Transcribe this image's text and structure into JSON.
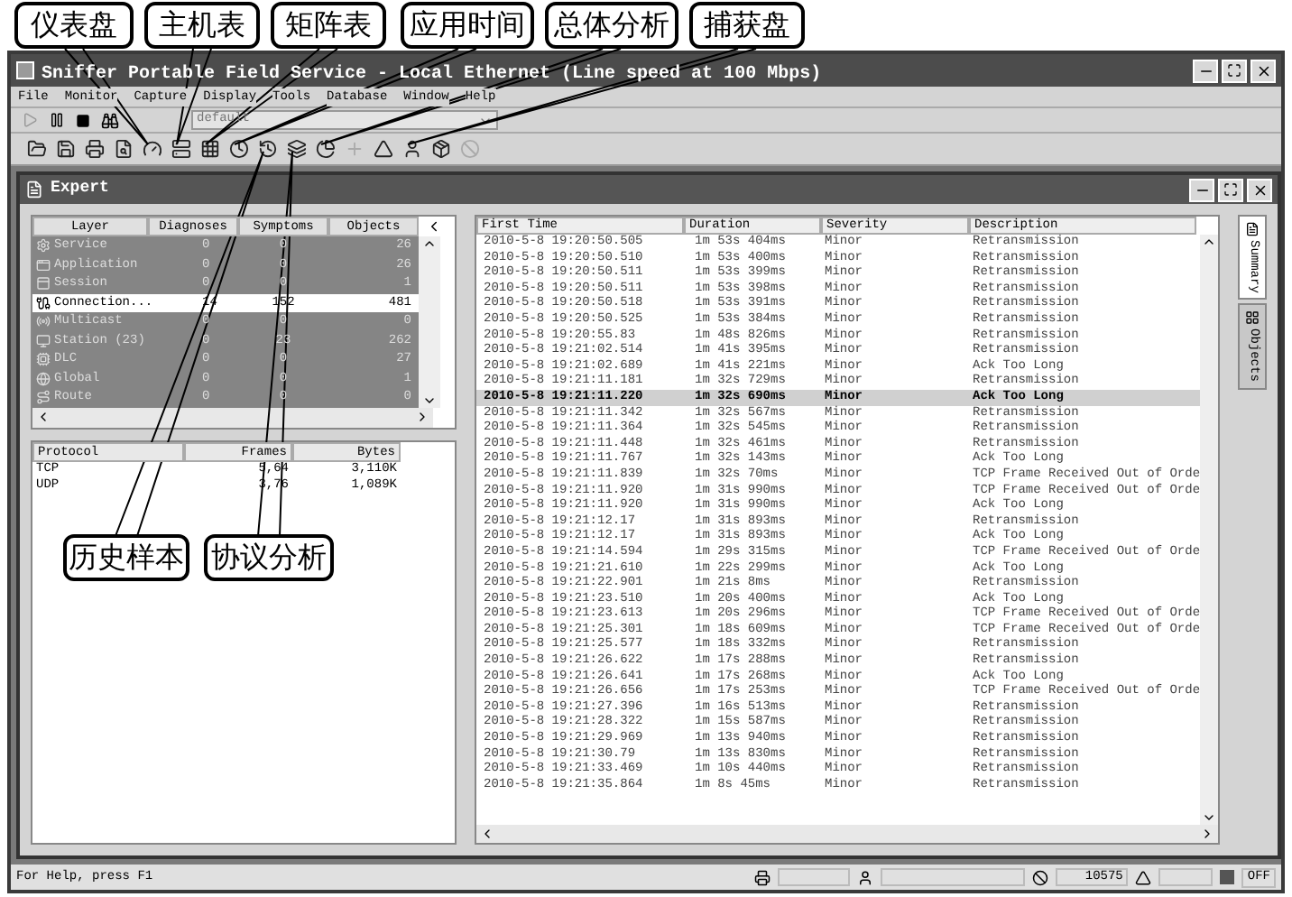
{
  "top_callouts": [
    "仪表盘",
    "主机表",
    "矩阵表",
    "应用时间",
    "总体分析",
    "捕获盘"
  ],
  "bottom_callouts": [
    "历史样本",
    "协议分析"
  ],
  "window": {
    "title": "Sniffer Portable Field Service - Local Ethernet (Line speed at 100 Mbps)"
  },
  "menu": [
    "File",
    "Monitor",
    "Capture",
    "Display",
    "Tools",
    "Database",
    "Window",
    "Help"
  ],
  "toolbar": {
    "dropdown": {
      "value": "default",
      "disabled": true
    }
  },
  "expert": {
    "title": "Expert",
    "layer_table": {
      "columns": [
        "Layer",
        "Diagnoses",
        "Symptoms",
        "Objects"
      ],
      "rows": [
        {
          "name": "Service",
          "diagnoses": "0",
          "symptoms": "0",
          "objects": "26",
          "selected": false
        },
        {
          "name": "Application",
          "diagnoses": "0",
          "symptoms": "0",
          "objects": "26",
          "selected": false
        },
        {
          "name": "Session",
          "diagnoses": "0",
          "symptoms": "0",
          "objects": "1",
          "selected": false
        },
        {
          "name": "Connection...",
          "diagnoses": "14",
          "symptoms": "152",
          "objects": "481",
          "selected": true
        },
        {
          "name": "Multicast",
          "diagnoses": "0",
          "symptoms": "0",
          "objects": "0",
          "selected": false
        },
        {
          "name": "Station (23)",
          "diagnoses": "0",
          "symptoms": "23",
          "objects": "262",
          "selected": false
        },
        {
          "name": "DLC",
          "diagnoses": "0",
          "symptoms": "0",
          "objects": "27",
          "selected": false
        },
        {
          "name": "Global",
          "diagnoses": "0",
          "symptoms": "0",
          "objects": "1",
          "selected": false
        },
        {
          "name": "Route",
          "diagnoses": "0",
          "symptoms": "0",
          "objects": "0",
          "selected": false
        }
      ]
    },
    "protocol_table": {
      "columns": [
        "Protocol",
        "Frames",
        "Bytes"
      ],
      "rows": [
        {
          "protocol": "TCP",
          "frames": "5,64",
          "bytes": "3,110K"
        },
        {
          "protocol": "UDP",
          "frames": "3,76",
          "bytes": "1,089K"
        }
      ]
    },
    "events_table": {
      "columns": [
        "First Time",
        "Duration",
        "Severity",
        "Description"
      ],
      "rows": [
        {
          "time": "2010-5-8 19:20:50.505",
          "duration": "1m 53s 404ms",
          "severity": "Minor",
          "description": "Retransmission",
          "selected": false
        },
        {
          "time": "2010-5-8 19:20:50.510",
          "duration": "1m 53s 400ms",
          "severity": "Minor",
          "description": "Retransmission",
          "selected": false
        },
        {
          "time": "2010-5-8 19:20:50.511",
          "duration": "1m 53s 399ms",
          "severity": "Minor",
          "description": "Retransmission",
          "selected": false
        },
        {
          "time": "2010-5-8 19:20:50.511",
          "duration": "1m 53s 398ms",
          "severity": "Minor",
          "description": "Retransmission",
          "selected": false
        },
        {
          "time": "2010-5-8 19:20:50.518",
          "duration": "1m 53s 391ms",
          "severity": "Minor",
          "description": "Retransmission",
          "selected": false
        },
        {
          "time": "2010-5-8 19:20:50.525",
          "duration": "1m 53s 384ms",
          "severity": "Minor",
          "description": "Retransmission",
          "selected": false
        },
        {
          "time": "2010-5-8 19:20:55.83",
          "duration": "1m 48s 826ms",
          "severity": "Minor",
          "description": "Retransmission",
          "selected": false
        },
        {
          "time": "2010-5-8 19:21:02.514",
          "duration": "1m 41s 395ms",
          "severity": "Minor",
          "description": "Retransmission",
          "selected": false
        },
        {
          "time": "2010-5-8 19:21:02.689",
          "duration": "1m 41s 221ms",
          "severity": "Minor",
          "description": "Ack Too Long",
          "selected": false
        },
        {
          "time": "2010-5-8 19:21:11.181",
          "duration": "1m 32s 729ms",
          "severity": "Minor",
          "description": "Retransmission",
          "selected": false
        },
        {
          "time": "2010-5-8 19:21:11.220",
          "duration": "1m 32s 690ms",
          "severity": "Minor",
          "description": "Ack Too Long",
          "selected": true
        },
        {
          "time": "2010-5-8 19:21:11.342",
          "duration": "1m 32s 567ms",
          "severity": "Minor",
          "description": "Retransmission",
          "selected": false
        },
        {
          "time": "2010-5-8 19:21:11.364",
          "duration": "1m 32s 545ms",
          "severity": "Minor",
          "description": "Retransmission",
          "selected": false
        },
        {
          "time": "2010-5-8 19:21:11.448",
          "duration": "1m 32s 461ms",
          "severity": "Minor",
          "description": "Retransmission",
          "selected": false
        },
        {
          "time": "2010-5-8 19:21:11.767",
          "duration": "1m 32s 143ms",
          "severity": "Minor",
          "description": "Ack Too Long",
          "selected": false
        },
        {
          "time": "2010-5-8 19:21:11.839",
          "duration": "1m 32s 70ms",
          "severity": "Minor",
          "description": "TCP Frame Received Out of Orde",
          "selected": false
        },
        {
          "time": "2010-5-8 19:21:11.920",
          "duration": "1m 31s 990ms",
          "severity": "Minor",
          "description": "TCP Frame Received Out of Orde",
          "selected": false
        },
        {
          "time": "2010-5-8 19:21:11.920",
          "duration": "1m 31s 990ms",
          "severity": "Minor",
          "description": "Ack Too Long",
          "selected": false
        },
        {
          "time": "2010-5-8 19:21:12.17",
          "duration": "1m 31s 893ms",
          "severity": "Minor",
          "description": "Retransmission",
          "selected": false
        },
        {
          "time": "2010-5-8 19:21:12.17",
          "duration": "1m 31s 893ms",
          "severity": "Minor",
          "description": "Ack Too Long",
          "selected": false
        },
        {
          "time": "2010-5-8 19:21:14.594",
          "duration": "1m 29s 315ms",
          "severity": "Minor",
          "description": "TCP Frame Received Out of Orde",
          "selected": false
        },
        {
          "time": "2010-5-8 19:21:21.610",
          "duration": "1m 22s 299ms",
          "severity": "Minor",
          "description": "Ack Too Long",
          "selected": false
        },
        {
          "time": "2010-5-8 19:21:22.901",
          "duration": "1m 21s 8ms",
          "severity": "Minor",
          "description": "Retransmission",
          "selected": false
        },
        {
          "time": "2010-5-8 19:21:23.510",
          "duration": "1m 20s 400ms",
          "severity": "Minor",
          "description": "Ack Too Long",
          "selected": false
        },
        {
          "time": "2010-5-8 19:21:23.613",
          "duration": "1m 20s 296ms",
          "severity": "Minor",
          "description": "TCP Frame Received Out of Orde",
          "selected": false
        },
        {
          "time": "2010-5-8 19:21:25.301",
          "duration": "1m 18s 609ms",
          "severity": "Minor",
          "description": "TCP Frame Received Out of Orde",
          "selected": false
        },
        {
          "time": "2010-5-8 19:21:25.577",
          "duration": "1m 18s 332ms",
          "severity": "Minor",
          "description": "Retransmission",
          "selected": false
        },
        {
          "time": "2010-5-8 19:21:26.622",
          "duration": "1m 17s 288ms",
          "severity": "Minor",
          "description": "Retransmission",
          "selected": false
        },
        {
          "time": "2010-5-8 19:21:26.641",
          "duration": "1m 17s 268ms",
          "severity": "Minor",
          "description": "Ack Too Long",
          "selected": false
        },
        {
          "time": "2010-5-8 19:21:26.656",
          "duration": "1m 17s 253ms",
          "severity": "Minor",
          "description": "TCP Frame Received Out of Orde",
          "selected": false
        },
        {
          "time": "2010-5-8 19:21:27.396",
          "duration": "1m 16s 513ms",
          "severity": "Minor",
          "description": "Retransmission",
          "selected": false
        },
        {
          "time": "2010-5-8 19:21:28.322",
          "duration": "1m 15s 587ms",
          "severity": "Minor",
          "description": "Retransmission",
          "selected": false
        },
        {
          "time": "2010-5-8 19:21:29.969",
          "duration": "1m 13s 940ms",
          "severity": "Minor",
          "description": "Retransmission",
          "selected": false
        },
        {
          "time": "2010-5-8 19:21:30.79",
          "duration": "1m 13s 830ms",
          "severity": "Minor",
          "description": "Retransmission",
          "selected": false
        },
        {
          "time": "2010-5-8 19:21:33.469",
          "duration": "1m 10s 440ms",
          "severity": "Minor",
          "description": "Retransmission",
          "selected": false
        },
        {
          "time": "2010-5-8 19:21:35.864",
          "duration": "1m 8s 45ms",
          "severity": "Minor",
          "description": "Retransmission",
          "selected": false
        }
      ]
    },
    "side_tabs": [
      {
        "label": "Summary",
        "selected": true
      },
      {
        "label": "Objects",
        "selected": false
      }
    ]
  },
  "status_bar": {
    "help": "For Help, press F1",
    "count": "10575",
    "mode": "OFF"
  }
}
